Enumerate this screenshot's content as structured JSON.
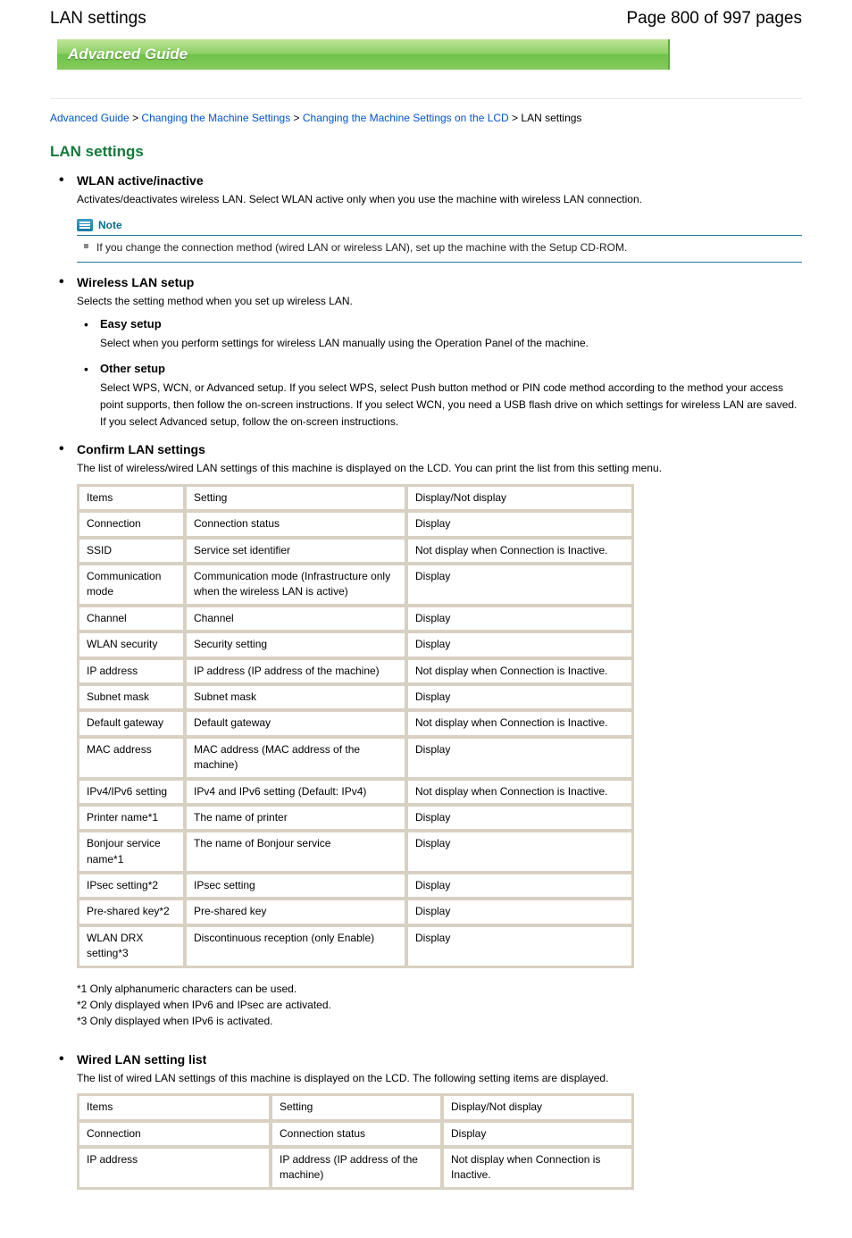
{
  "header": {
    "title": "LAN settings",
    "page_counter": "Page 800 of 997 pages"
  },
  "banner": "Advanced Guide",
  "breadcrumb": {
    "l1": "Advanced Guide",
    "l2": "Changing the Machine Settings",
    "l3": "Changing the Machine Settings on the LCD",
    "l4": "LAN settings",
    "sep": " > "
  },
  "section": "LAN settings",
  "items": [
    {
      "head": "WLAN active/inactive",
      "body": "Activates/deactivates wireless LAN. Select WLAN active only when you use the machine with wireless LAN connection.",
      "note": {
        "label": "Note",
        "text": "If you change the connection method (wired LAN or wireless LAN), set up the machine with the Setup CD-ROM."
      }
    },
    {
      "head": "Wireless LAN setup",
      "body": "Selects the setting method when you set up wireless LAN.",
      "subs": [
        {
          "head": "Easy setup",
          "body": "Select when you perform settings for wireless LAN manually using the Operation Panel of the machine."
        },
        {
          "head": "Other setup",
          "body": "Select WPS, WCN, or Advanced setup. If you select WPS, select Push button method or PIN code method according to the method your access point supports, then follow the on-screen instructions. If you select WCN, you need a USB flash drive on which settings for wireless LAN are saved. If you select Advanced setup, follow the on-screen instructions."
        }
      ]
    },
    {
      "head": "Confirm LAN settings",
      "body": "The list of wireless/wired LAN settings of this machine is displayed on the LCD. You can print the list from this setting menu.",
      "table": {
        "rows": [
          [
            "Items",
            "Setting",
            "Display/Not display"
          ],
          [
            "Connection",
            "Connection status",
            "Display"
          ],
          [
            "SSID",
            "Service set identifier",
            "Not display when Connection is Inactive."
          ],
          [
            "Communication mode",
            "Communication mode (Infrastructure only when the wireless LAN is active)",
            "Display"
          ],
          [
            "Channel",
            "Channel",
            "Display"
          ],
          [
            "WLAN security",
            "Security setting",
            "Display"
          ],
          [
            "IP address",
            "IP address (IP address of the machine)",
            "Not display when Connection is Inactive."
          ],
          [
            "Subnet mask",
            "Subnet mask",
            "Display"
          ],
          [
            "Default gateway",
            "Default gateway",
            "Not display when Connection is Inactive."
          ],
          [
            "MAC address",
            "MAC address (MAC address of the machine)",
            "Display"
          ],
          [
            "IPv4/IPv6 setting",
            "IPv4 and IPv6 setting (Default: IPv4)",
            "Not display when Connection is Inactive."
          ],
          [
            "Printer name*1",
            "The name of printer",
            "Display"
          ],
          [
            "Bonjour service name*1",
            "The name of Bonjour service",
            "Display"
          ],
          [
            "IPsec setting*2",
            "IPsec setting",
            "Display"
          ],
          [
            "Pre-shared key*2",
            "Pre-shared key",
            "Display"
          ],
          [
            "WLAN DRX setting*3",
            "Discontinuous reception (only Enable)",
            "Display"
          ]
        ],
        "footnotes": "*1 Only alphanumeric characters can be used.\n*2 Only displayed when IPv6 and IPsec are activated.\n*3 Only displayed when IPv6 is activated."
      }
    },
    {
      "head": "Wired LAN setting list",
      "body": "The list of wired LAN settings of this machine is displayed on the LCD. The following setting items are displayed.",
      "table": {
        "rows": [
          [
            "Items",
            "Setting",
            "Display/Not display"
          ],
          [
            "Connection",
            "Connection status",
            "Display"
          ],
          [
            "IP address",
            "IP address (IP address of the machine)",
            "Not display when Connection is Inactive."
          ]
        ]
      }
    }
  ]
}
